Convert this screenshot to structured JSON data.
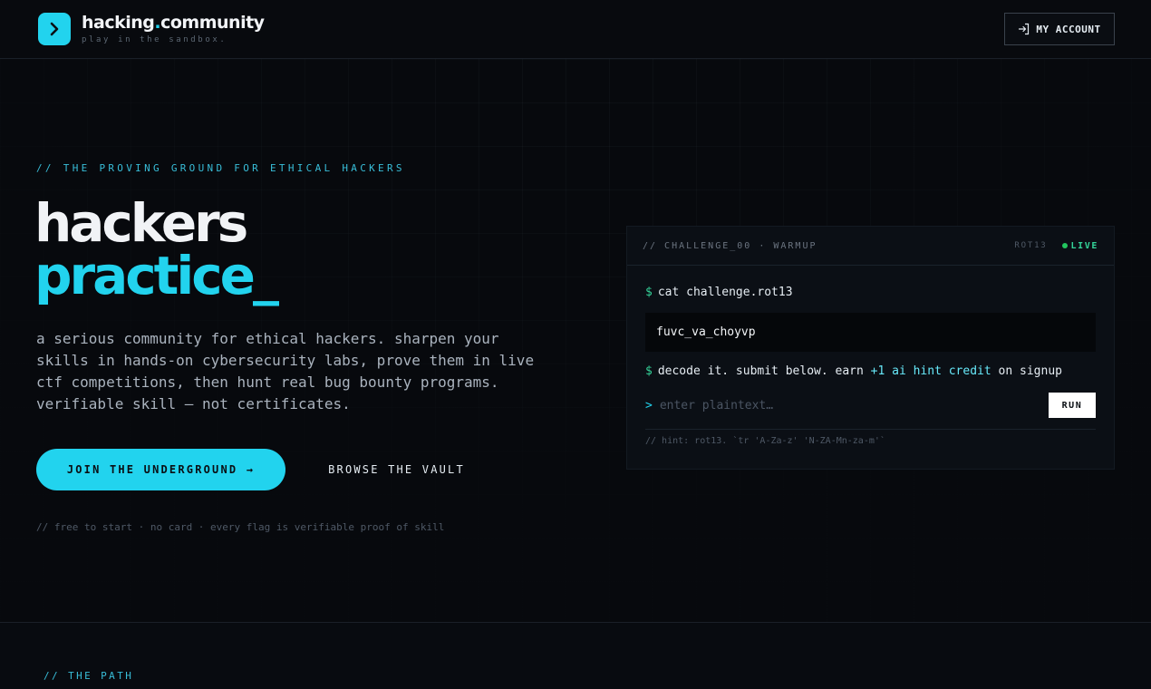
{
  "brand": {
    "name_main": "hacking",
    "name_dot": ".",
    "name_tail": "community",
    "tagline": "play in the sandbox.",
    "logo_icon": "chevron-right-icon",
    "accent_color": "#22d3ee"
  },
  "header": {
    "account_label": "MY ACCOUNT",
    "account_icon": "sign-in-icon"
  },
  "hero": {
    "eyebrow": "// THE PROVING GROUND FOR ETHICAL HACKERS",
    "headline_line1": "hackers",
    "headline_line2": "practice_",
    "description": "a serious community for ethical hackers. sharpen your skills in hands-on cybersecurity labs, prove them in live ctf competitions, then hunt real bug bounty programs. verifiable skill — not certificates.",
    "cta_primary": "JOIN THE UNDERGROUND →",
    "cta_secondary": "BROWSE THE VAULT",
    "fineprint": "// free to start · no card · every flag is verifiable proof of skill"
  },
  "terminal": {
    "title": "// CHALLENGE_00 · WARMUP",
    "cipher_tag": "ROT13",
    "status": "LIVE",
    "status_color": "#22c55e",
    "prompt_symbol": "$",
    "command": "cat challenge.rot13",
    "ciphertext": "fuvc_va_choyvp",
    "instruction_before": "decode it. submit below. earn ",
    "instruction_credit": "+1 ai hint credit",
    "instruction_after": " on signup",
    "input_caret": ">",
    "input_placeholder": "enter plaintext…",
    "run_label": "RUN",
    "hint": "// hint: rot13. `tr 'A-Za-z' 'N-ZA-Mn-za-m'`"
  },
  "path": {
    "label": "// THE PATH"
  }
}
